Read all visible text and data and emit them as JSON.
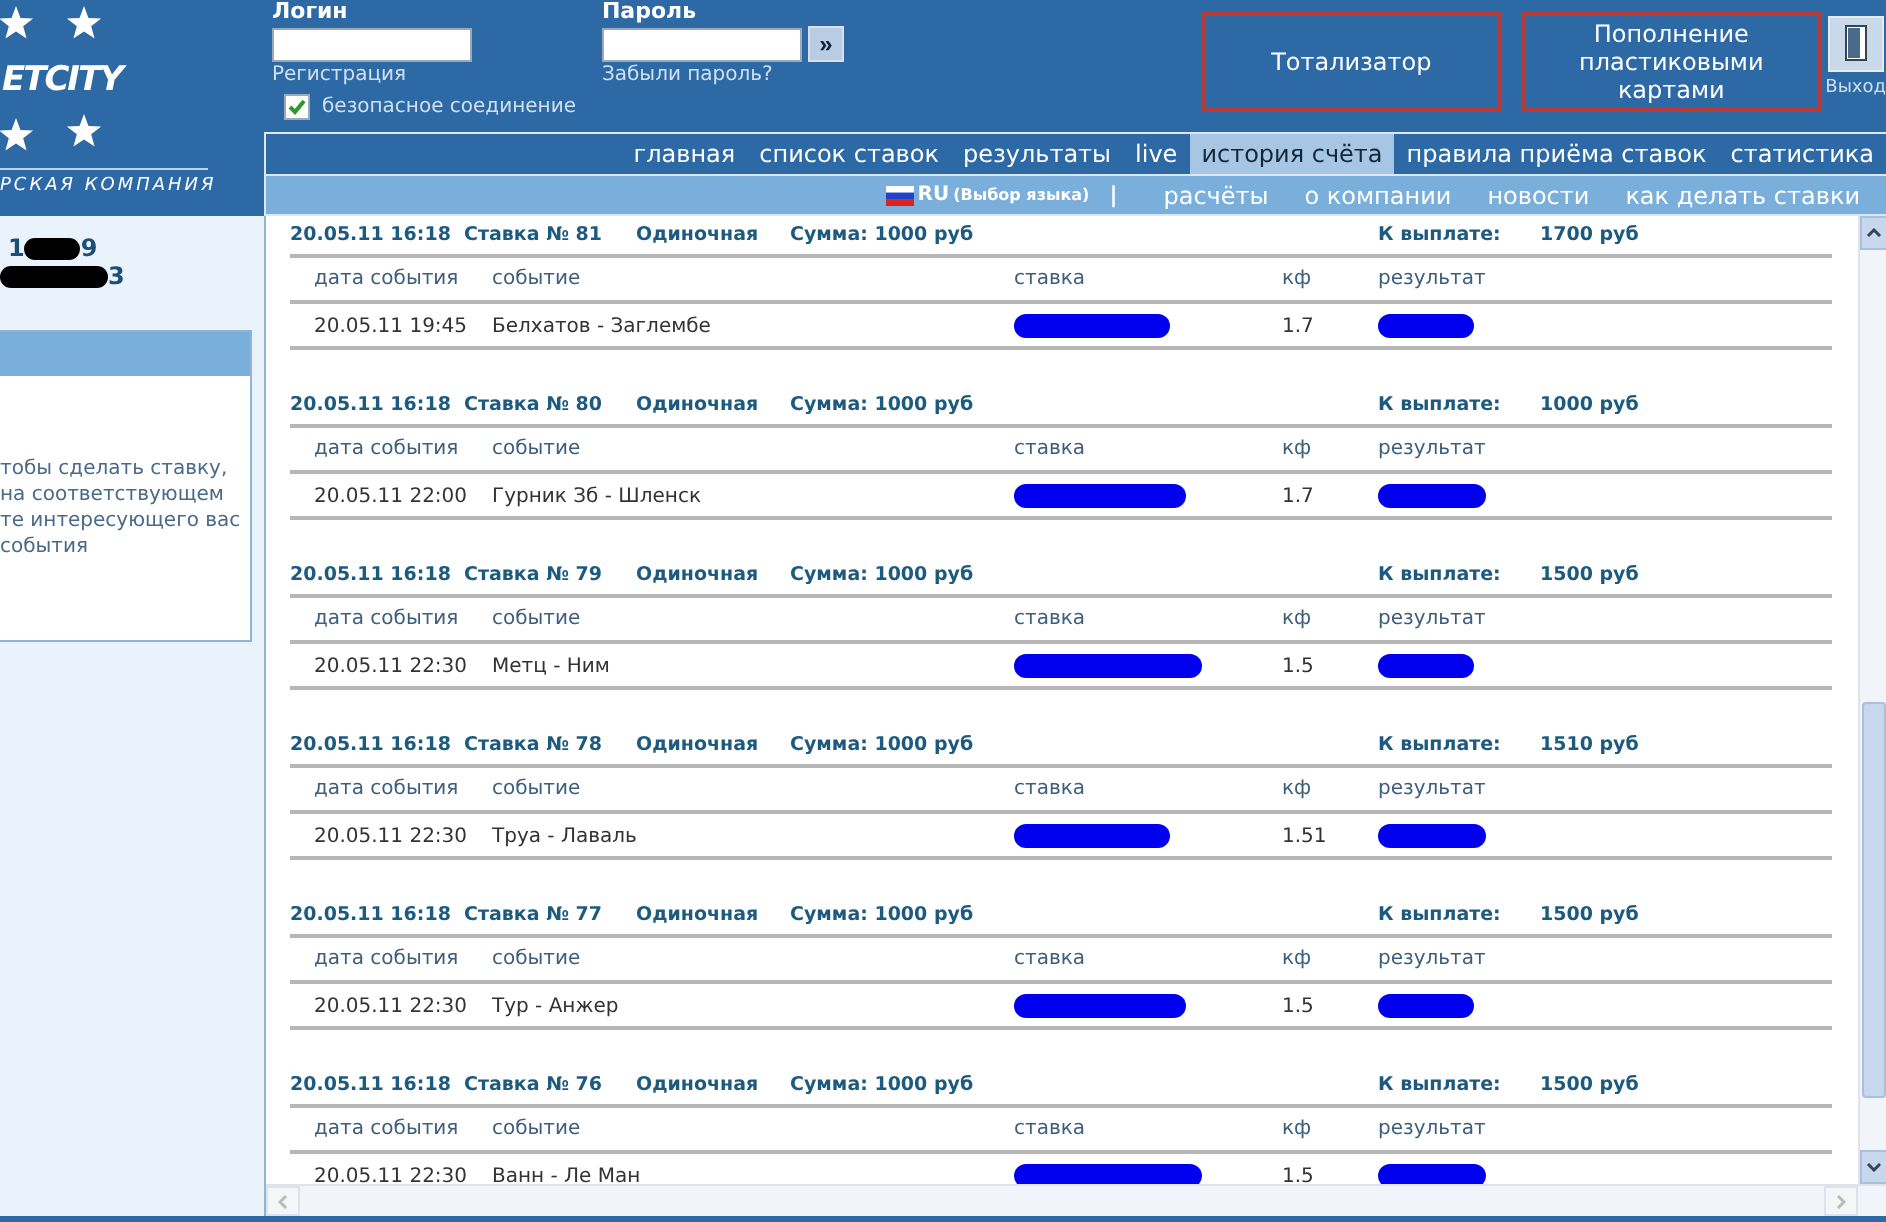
{
  "logo": {
    "name": "ETCITY",
    "tagline": "РСКАЯ КОМПАНИЯ"
  },
  "login": {
    "label": "Логин",
    "link": "Регистрация"
  },
  "password": {
    "label": "Пароль",
    "link": "Забыли пароль?"
  },
  "submit": "»",
  "secure": {
    "label": "безопасное соединение",
    "checked": true
  },
  "promos": [
    "Тотализатор",
    "Пополнение пластиковыми картами"
  ],
  "exit": "Выход",
  "nav": [
    {
      "label": "главная",
      "selected": false
    },
    {
      "label": "список ставок",
      "selected": false
    },
    {
      "label": "результаты",
      "selected": false
    },
    {
      "label": "live",
      "selected": false
    },
    {
      "label": "история счёта",
      "selected": true
    },
    {
      "label": "правила приёма ставок",
      "selected": false
    },
    {
      "label": "статистика",
      "selected": false
    }
  ],
  "subnav": {
    "language": "RU",
    "language_hint": "(Выбор языка)",
    "separator": "|",
    "items": [
      "расчёты",
      "о компании",
      "новости",
      "как делать ставки"
    ]
  },
  "account": [
    {
      "prefix": "1",
      "suffix": "9"
    },
    {
      "suffix": "3"
    }
  ],
  "sidebar_text": [
    "тобы сделать ставку,",
    "на соответствующем",
    "те интересующего вас",
    "события"
  ],
  "bets": [
    {
      "placed": "20.05.11 16:18",
      "number": "Ставка № 81",
      "type": "Одиночная",
      "sum": "Сумма: 1000 руб",
      "payout_label": "К выплате:",
      "payout": "1700 руб",
      "columns": [
        "дата события",
        "событие",
        "ставка",
        "кф",
        "результат"
      ],
      "row": {
        "date": "20.05.11 19:45",
        "event": "Белхатов - Заглембе",
        "odds": "1.7"
      }
    },
    {
      "placed": "20.05.11 16:18",
      "number": "Ставка № 80",
      "type": "Одиночная",
      "sum": "Сумма: 1000 руб",
      "payout_label": "К выплате:",
      "payout": "1000 руб",
      "columns": [
        "дата события",
        "событие",
        "ставка",
        "кф",
        "результат"
      ],
      "row": {
        "date": "20.05.11 22:00",
        "event": "Гурник Зб - Шленск",
        "odds": "1.7"
      }
    },
    {
      "placed": "20.05.11 16:18",
      "number": "Ставка № 79",
      "type": "Одиночная",
      "sum": "Сумма: 1000 руб",
      "payout_label": "К выплате:",
      "payout": "1500 руб",
      "columns": [
        "дата события",
        "событие",
        "ставка",
        "кф",
        "результат"
      ],
      "row": {
        "date": "20.05.11 22:30",
        "event": "Метц - Ним",
        "odds": "1.5"
      }
    },
    {
      "placed": "20.05.11 16:18",
      "number": "Ставка № 78",
      "type": "Одиночная",
      "sum": "Сумма: 1000 руб",
      "payout_label": "К выплате:",
      "payout": "1510 руб",
      "columns": [
        "дата события",
        "событие",
        "ставка",
        "кф",
        "результат"
      ],
      "row": {
        "date": "20.05.11 22:30",
        "event": "Труа - Лаваль",
        "odds": "1.51"
      }
    },
    {
      "placed": "20.05.11 16:18",
      "number": "Ставка № 77",
      "type": "Одиночная",
      "sum": "Сумма: 1000 руб",
      "payout_label": "К выплате:",
      "payout": "1500 руб",
      "columns": [
        "дата события",
        "событие",
        "ставка",
        "кф",
        "результат"
      ],
      "row": {
        "date": "20.05.11 22:30",
        "event": "Тур - Анжер",
        "odds": "1.5"
      }
    },
    {
      "placed": "20.05.11 16:18",
      "number": "Ставка № 76",
      "type": "Одиночная",
      "sum": "Сумма: 1000 руб",
      "payout_label": "К выплате:",
      "payout": "1500 руб",
      "columns": [
        "дата события",
        "событие",
        "ставка",
        "кф",
        "результат"
      ],
      "row": {
        "date": "20.05.11 22:30",
        "event": "Ванн - Ле Ман",
        "odds": "1.5"
      }
    }
  ]
}
